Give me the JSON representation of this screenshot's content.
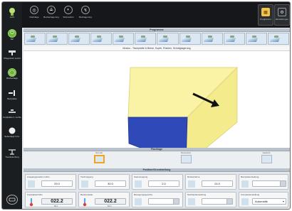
{
  "colors": {
    "accent": "#f2a51a",
    "sidebar": "#1b1e21",
    "green": "#6fb23a",
    "box_top": "#faf3a6",
    "box_front": "#f4eb8c",
    "box_side": "#2f4ab8"
  },
  "sidebar": {
    "items": [
      {
        "label": "Licht",
        "icon": "light-icon"
      },
      {
        "label": "Ein",
        "icon": "power-icon"
      },
      {
        "label": "Pflegetisch Leicht",
        "icon": "table-icon"
      },
      {
        "label": "Rückenlage",
        "icon": "power-ring-icon"
      },
      {
        "label": "Beinplatte",
        "icon": "leg-plate-icon"
      },
      {
        "label": "Kopfplatte li. rechts",
        "icon": "head-plate-icon"
      },
      {
        "label": "Seitenlage li./re.",
        "icon": "side-tilt-icon"
      },
      {
        "label": "Trendelenburg",
        "icon": "trendelenburg-icon"
      },
      {
        "label": "",
        "icon": "hand-control-icon"
      }
    ]
  },
  "topbar": {
    "buttons": [
      {
        "label": "Flachlage",
        "icon": "flat-icon"
      },
      {
        "label": "Beckenlagerung",
        "icon": "pelvis-icon"
      },
      {
        "label": "Sitzposition",
        "icon": "sit-icon"
      },
      {
        "label": "Beinlagerung",
        "icon": "leg-icon"
      }
    ],
    "right": [
      {
        "label": "Programme",
        "icon": "program-icon"
      },
      {
        "label": "Einstellungen",
        "icon": "settings-icon"
      }
    ]
  },
  "program_strip": {
    "title": "Programme",
    "tile_count": 12
  },
  "main": {
    "title": "Modus - Tischplatte & Beine, Kopfe, Rücken, Schräglagerung"
  },
  "footer_strip": {
    "title": "Flachlage",
    "tiles": [
      {
        "label": "Normal",
        "active": true
      },
      {
        "label": "Reversiert",
        "active": false
      },
      {
        "label": "Gedreht",
        "active": false
      }
    ]
  },
  "settings": {
    "title": "Position/Grundstellung",
    "cards": [
      {
        "title": "Ausgangsposition Höhe",
        "value": "29.0"
      },
      {
        "title": "Tischneigung",
        "value": "30.0"
      },
      {
        "title": "Seitenneigung",
        "value": "2.0"
      },
      {
        "title": "Rückenlehne",
        "value": "24.0"
      },
      {
        "title": "Beinplattenstellung",
        "type": "toggle"
      },
      {
        "title": "Kopfplattenhöhe",
        "value": "022.2",
        "sub": "BS-1"
      },
      {
        "title": "Beckenplatte",
        "value": "022.2",
        "sub": "BS-2"
      },
      {
        "title": "Bewegungsgeschw.",
        "type": "toggle"
      },
      {
        "title": "Nachlaufeinstellung",
        "type": "toggle"
      },
      {
        "title": "Kompletteinstellung",
        "value": "Automatik",
        "type": "select"
      }
    ]
  }
}
